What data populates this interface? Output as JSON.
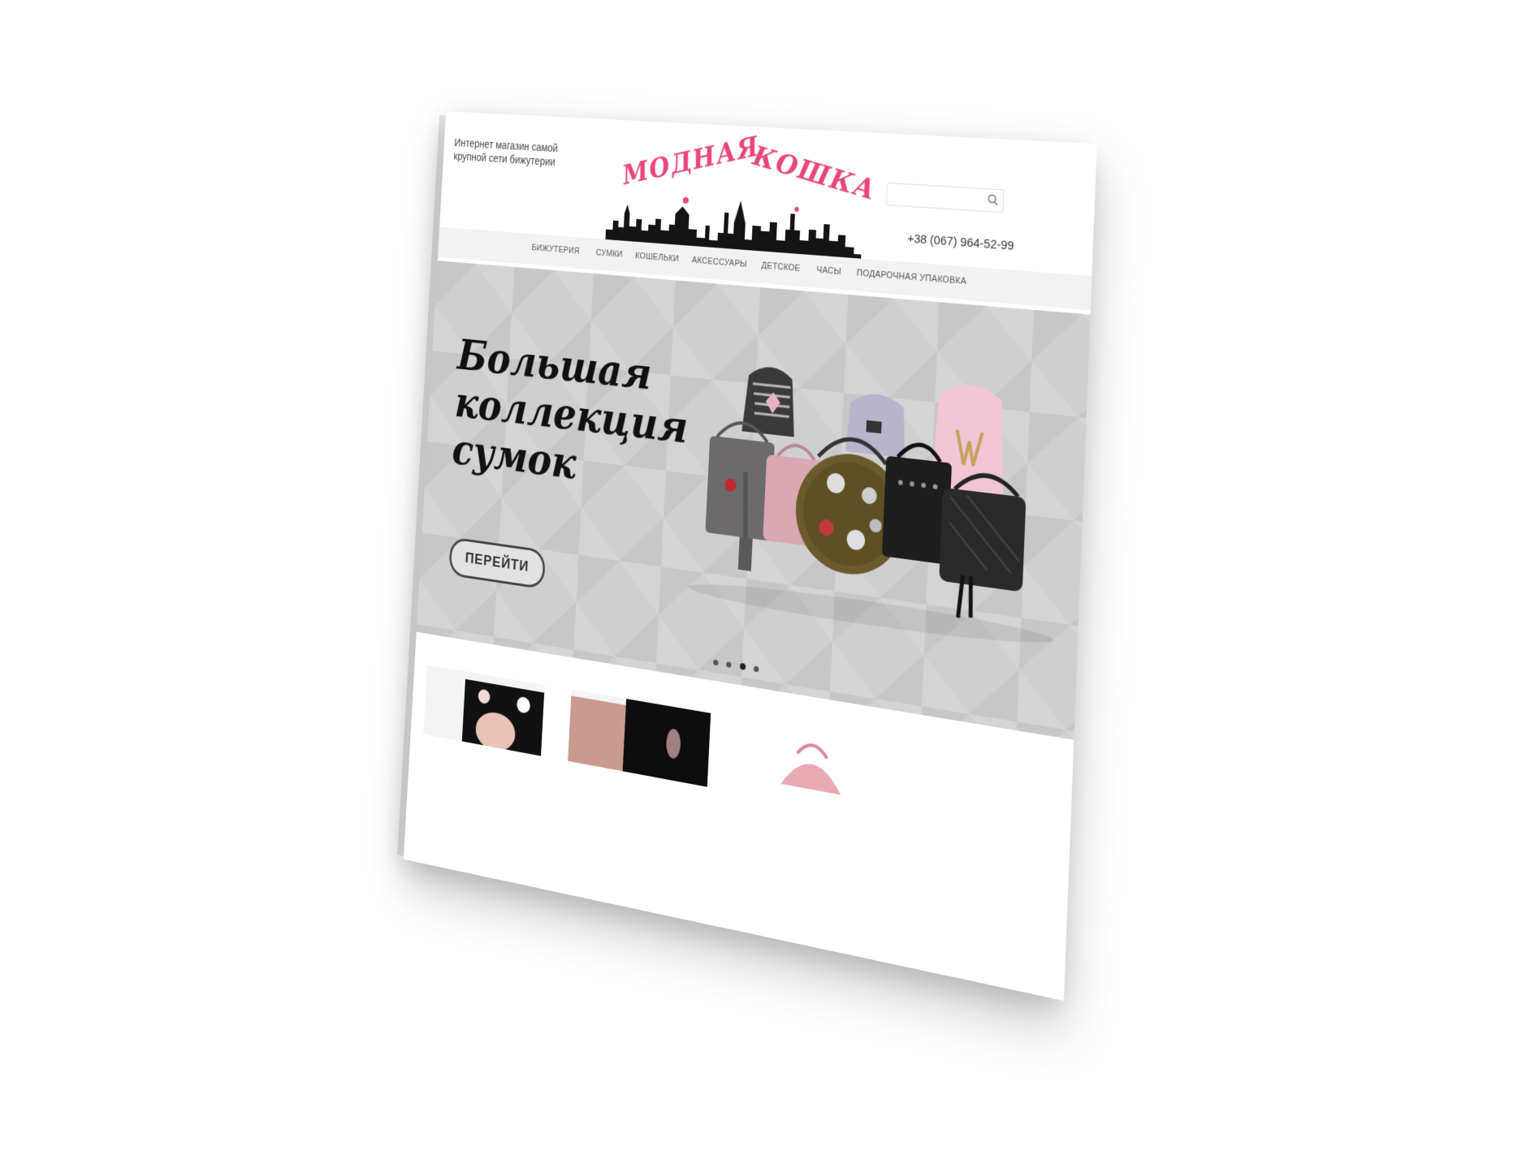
{
  "header": {
    "tagline": "Интернет магазин самой крупной сети бижутерии",
    "logo": {
      "word1": "МОДНАЯ",
      "word2": "КОШКА"
    },
    "search": {
      "value": "",
      "placeholder": ""
    },
    "phone": "+38 (067) 964-52-99"
  },
  "nav": {
    "items": [
      {
        "label": "Бижутерия"
      },
      {
        "label": "Сумки"
      },
      {
        "label": "Кошельки"
      },
      {
        "label": "Аксессуары"
      },
      {
        "label": "Детское"
      },
      {
        "label": "Часы"
      },
      {
        "label": "Подарочная упаковка"
      }
    ]
  },
  "hero": {
    "title_lines": [
      "Большая",
      "коллекция",
      "сумок"
    ],
    "button_label": "ПЕРЕЙТИ",
    "slider": {
      "count": 4,
      "active": 2
    }
  },
  "colors": {
    "brand_pink": "#e8457f",
    "hero_bg": "#cfcfcf",
    "nav_bg": "#f2f2f2",
    "text_dark": "#111111"
  },
  "icons": {
    "search": "search-icon"
  }
}
